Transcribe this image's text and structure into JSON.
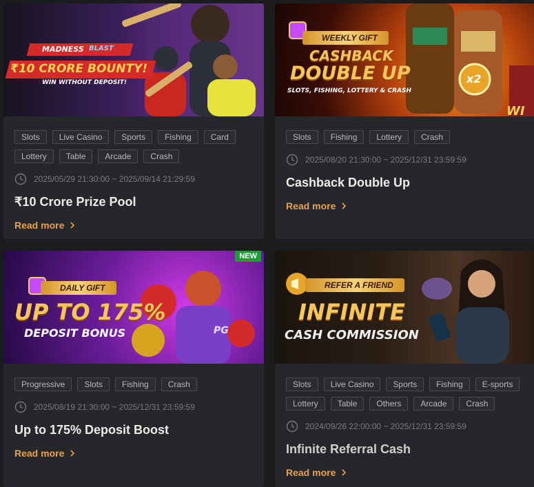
{
  "cards": [
    {
      "banner": {
        "headline": "₹10 CRORE BOUNTY!",
        "subline": "WIN WITHOUT DEPOSIT!",
        "brand": "MADNESS",
        "brand2": "BLAST"
      },
      "tags": [
        "Slots",
        "Live Casino",
        "Sports",
        "Fishing",
        "Card",
        "Lottery",
        "Table",
        "Arcade",
        "Crash"
      ],
      "date": "2025/05/29 21:30:00 ~ 2025/09/14 21:29:59",
      "title": "₹10 Crore Prize Pool",
      "read_more": "Read more"
    },
    {
      "banner": {
        "ribbon": "WEEKLY GIFT",
        "line1": "CASHBACK",
        "line2": "DOUBLE UP",
        "subline": "SLOTS, FISHING, LOTTERY & CRASH",
        "coin": "x2",
        "corner": "WI"
      },
      "tags": [
        "Slots",
        "Fishing",
        "Lottery",
        "Crash"
      ],
      "date": "2025/08/20 21:30:00 ~ 2025/12/31 23:59:59",
      "title": "Cashback Double Up",
      "read_more": "Read more"
    },
    {
      "banner": {
        "ribbon": "DAILY GIFT",
        "line1": "UP TO 175%",
        "line2": "DEPOSIT BONUS",
        "badge": "NEW",
        "shirt": "PG"
      },
      "tags": [
        "Progressive",
        "Slots",
        "Fishing",
        "Crash"
      ],
      "date": "2025/08/19 21:30:00 ~ 2025/12/31 23:59:59",
      "title": "Up to 175% Deposit Boost",
      "read_more": "Read more"
    },
    {
      "banner": {
        "ribbon": "REFER A FRIEND",
        "line1": "INFINITE",
        "line2": "CASH COMMISSION"
      },
      "tags": [
        "Slots",
        "Live Casino",
        "Sports",
        "Fishing",
        "E-sports",
        "Lottery",
        "Table",
        "Others",
        "Arcade",
        "Crash"
      ],
      "date": "2024/09/26 22:00:00 ~ 2025/12/31 23:59:59",
      "title": "Infinite Referral Cash",
      "read_more": "Read more"
    }
  ],
  "colors": {
    "page_bg": "#1b1c1e",
    "card_bg": "#26272a",
    "accent": "#e8a14f",
    "tag_border": "#4a4b4f",
    "new_badge": "#1f9b3a"
  },
  "icons": {
    "clock": "clock-icon",
    "chevron": "chevron-right-icon"
  }
}
